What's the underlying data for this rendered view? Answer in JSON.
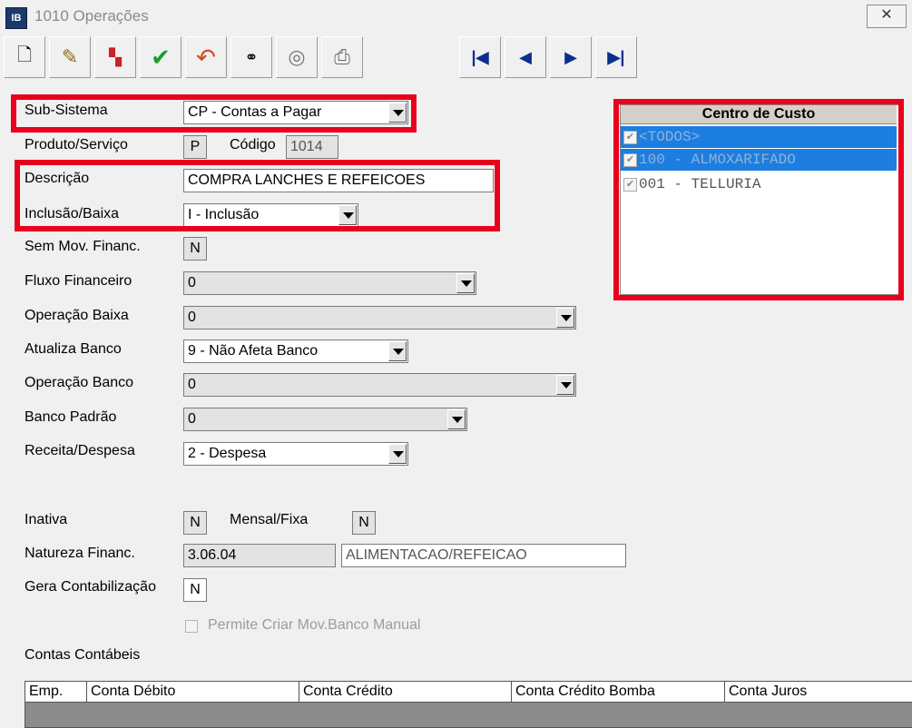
{
  "window": {
    "title": "1010 Operações",
    "close_label": "✕",
    "app_icon_text": "IB"
  },
  "toolbar": {
    "buttons": [
      {
        "icon": "new-document-icon",
        "glyph": "🗋"
      },
      {
        "icon": "edit-icon",
        "glyph": "✎"
      },
      {
        "icon": "popcorn-icon",
        "glyph": "🍿"
      },
      {
        "icon": "confirm-check-icon",
        "glyph": "✔"
      },
      {
        "icon": "undo-icon",
        "glyph": "↶"
      },
      {
        "icon": "binoculars-icon",
        "glyph": "👓"
      },
      {
        "icon": "search-disk-icon",
        "glyph": "💿"
      },
      {
        "icon": "printer-icon",
        "glyph": "🖶"
      }
    ],
    "nav": [
      {
        "icon": "first-record-icon",
        "glyph": "⏮"
      },
      {
        "icon": "prev-record-icon",
        "glyph": "◀"
      },
      {
        "icon": "next-record-icon",
        "glyph": "▶"
      },
      {
        "icon": "last-record-icon",
        "glyph": "⏭"
      }
    ]
  },
  "form": {
    "sub_sistema": {
      "label": "Sub-Sistema",
      "value": "CP - Contas a Pagar"
    },
    "produto_servico": {
      "label": "Produto/Serviço",
      "value": "P"
    },
    "codigo": {
      "label": "Código",
      "value": "1014"
    },
    "descricao": {
      "label": "Descrição",
      "value": "COMPRA LANCHES E REFEICOES"
    },
    "inclusao_baixa": {
      "label": "Inclusão/Baixa",
      "value": "I - Inclusão"
    },
    "sem_mov_financ": {
      "label": "Sem Mov. Financ.",
      "value": "N"
    },
    "fluxo_financeiro": {
      "label": "Fluxo Financeiro",
      "value": "0"
    },
    "operacao_baixa": {
      "label": "Operação Baixa",
      "value": "0"
    },
    "atualiza_banco": {
      "label": "Atualiza Banco",
      "value": "9 - Não Afeta Banco"
    },
    "operacao_banco": {
      "label": "Operação Banco",
      "value": "0"
    },
    "banco_padrao": {
      "label": "Banco Padrão",
      "value": "0"
    },
    "receita_despesa": {
      "label": "Receita/Despesa",
      "value": "2 - Despesa"
    },
    "inativa": {
      "label": "Inativa",
      "value": "N"
    },
    "mensal_fixa": {
      "label": "Mensal/Fixa",
      "value": "N"
    },
    "natureza_financ": {
      "label": "Natureza Financ.",
      "code": "3.06.04",
      "description": "ALIMENTACAO/REFEICAO"
    },
    "gera_contabilizacao": {
      "label": "Gera Contabilização",
      "value": "N"
    },
    "permite_criar": {
      "label": "Permite Criar Mov.Banco Manual",
      "checked": false
    }
  },
  "centro_de_custo": {
    "title": "Centro de Custo",
    "items": [
      {
        "label": "<TODOS>",
        "checked": true,
        "selected": true
      },
      {
        "label": "100 - ALMOXARIFADO",
        "checked": true,
        "selected": true
      },
      {
        "label": "001 - TELLURIA",
        "checked": true,
        "selected": false
      }
    ]
  },
  "contas_contabeis": {
    "title": "Contas Contábeis",
    "columns": [
      "Emp.",
      "Conta Débito",
      "Conta Crédito",
      "Conta Crédito Bomba",
      "Conta Juros"
    ]
  },
  "colors": {
    "highlight": "#e8001c",
    "selection": "#1c7ee0"
  }
}
